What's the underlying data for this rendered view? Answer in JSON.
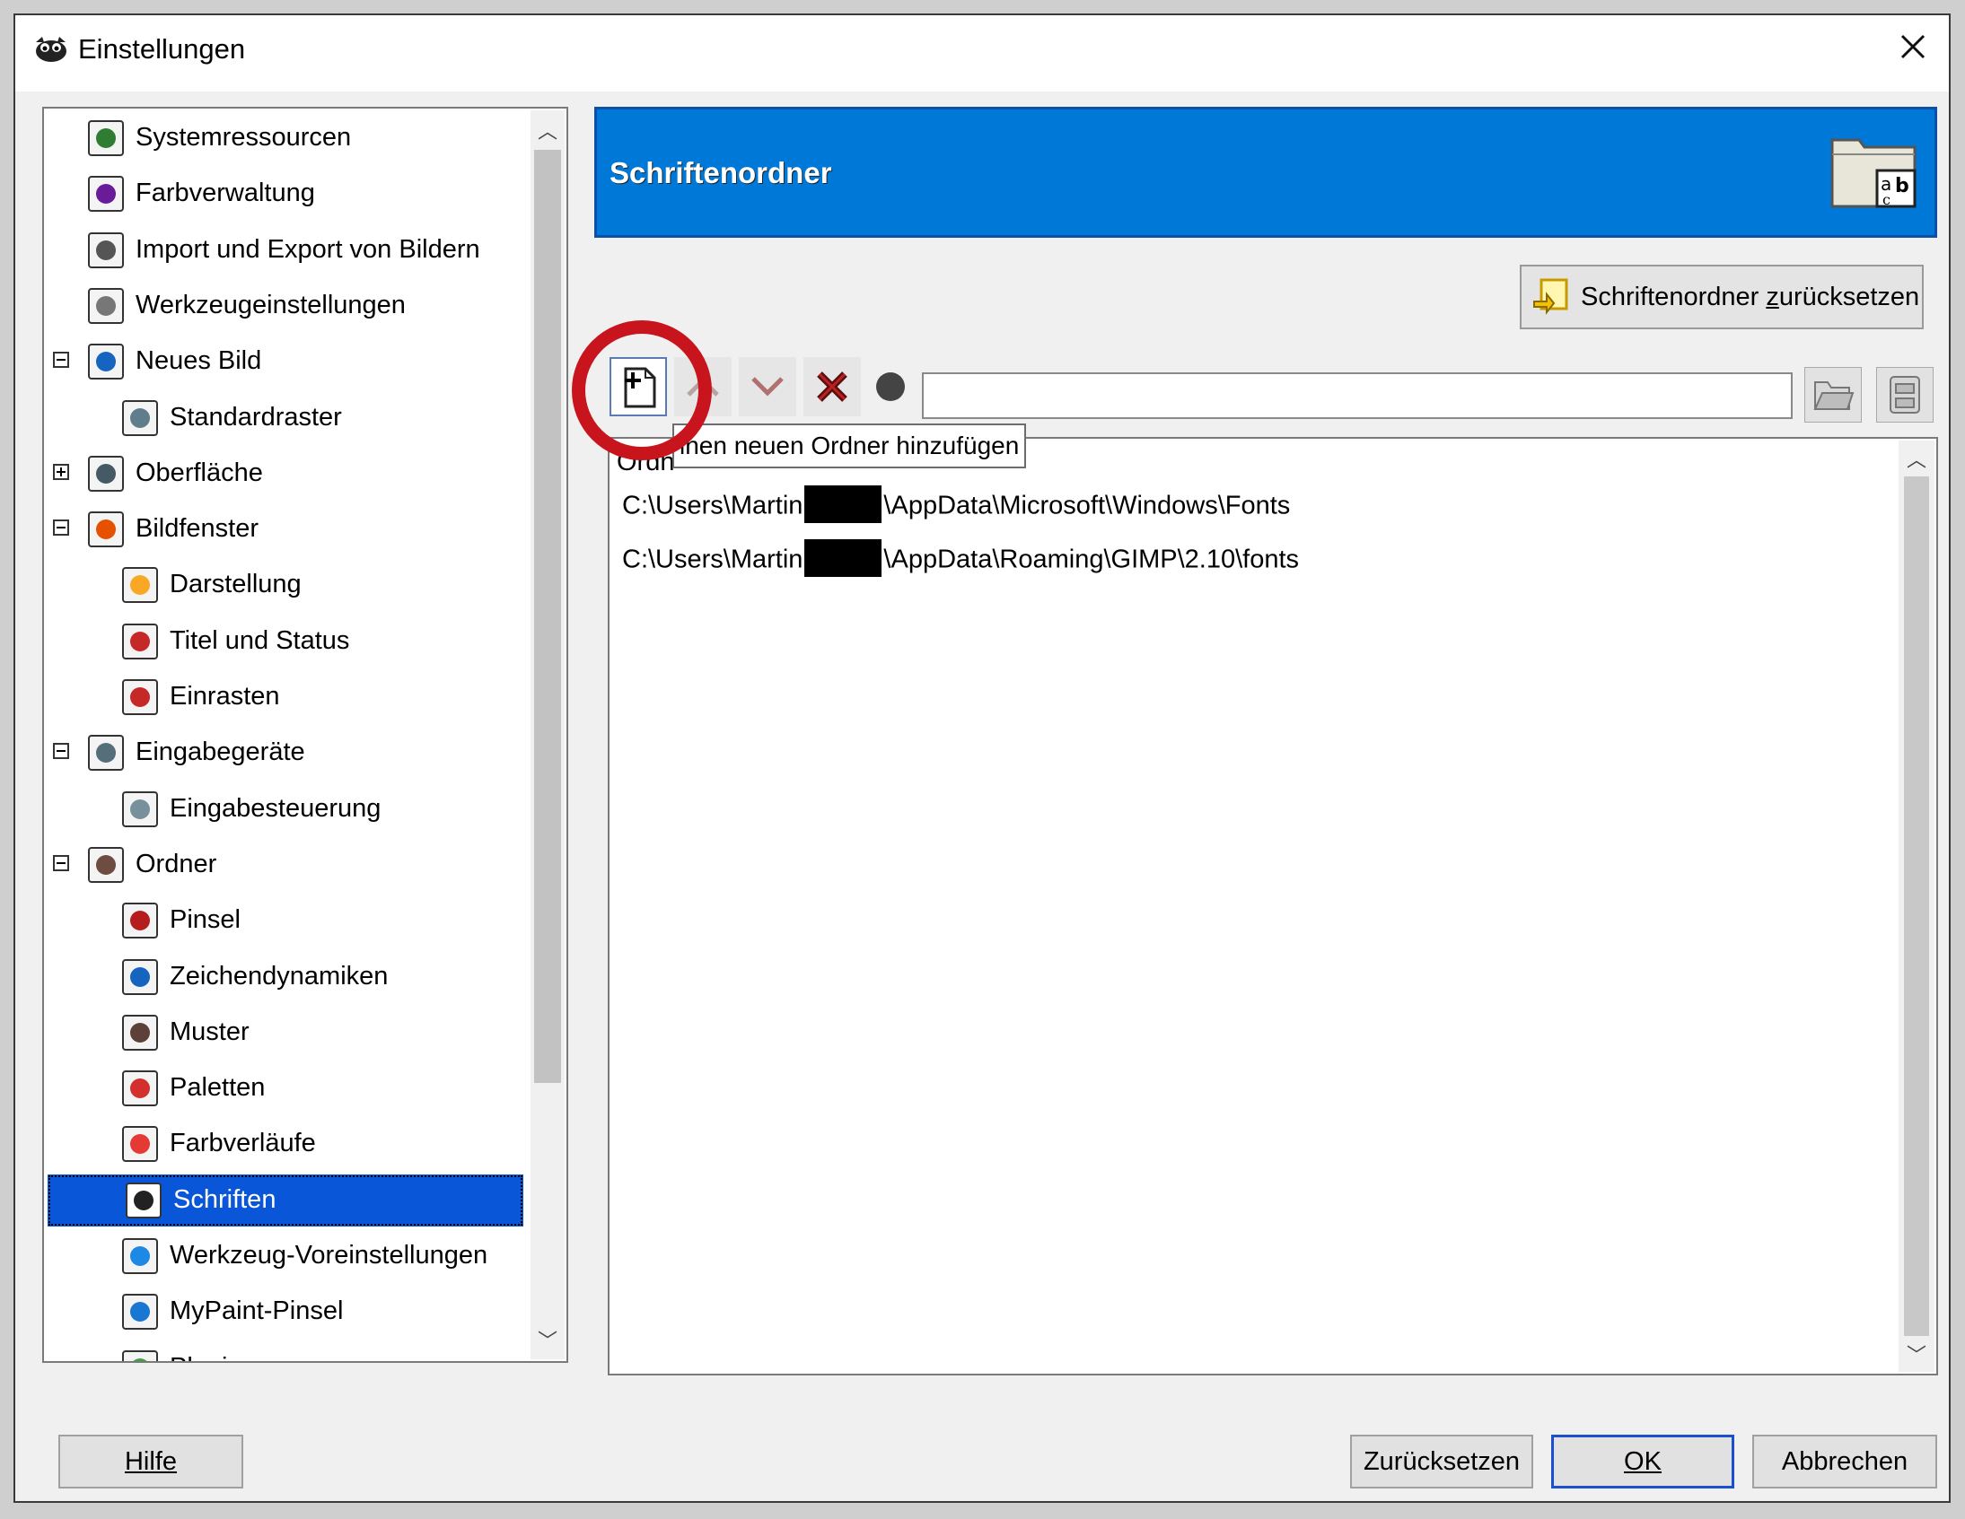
{
  "window": {
    "title": "Einstellungen",
    "close_label": "×"
  },
  "sidebar": {
    "items": [
      {
        "label": "Systemressourcen",
        "icon": "system-resources-icon"
      },
      {
        "label": "Farbverwaltung",
        "icon": "color-management-icon"
      },
      {
        "label": "Import und Export von Bildern",
        "icon": "import-export-icon"
      },
      {
        "label": "Werkzeugeinstellungen",
        "icon": "tool-options-icon"
      },
      {
        "label": "Neues Bild",
        "icon": "new-image-icon",
        "expanded": true
      },
      {
        "label": "Standardraster",
        "icon": "default-grid-icon"
      },
      {
        "label": "Oberfläche",
        "icon": "interface-icon",
        "expanded": false
      },
      {
        "label": "Bildfenster",
        "icon": "image-window-icon",
        "expanded": true
      },
      {
        "label": "Darstellung",
        "icon": "appearance-icon"
      },
      {
        "label": "Titel und Status",
        "icon": "title-status-icon"
      },
      {
        "label": "Einrasten",
        "icon": "snapping-icon"
      },
      {
        "label": "Eingabegeräte",
        "icon": "input-devices-icon",
        "expanded": true
      },
      {
        "label": "Eingabesteuerung",
        "icon": "input-controllers-icon"
      },
      {
        "label": "Ordner",
        "icon": "folders-icon",
        "expanded": true
      },
      {
        "label": "Pinsel",
        "icon": "brush-icon"
      },
      {
        "label": "Zeichendynamiken",
        "icon": "paint-dynamics-icon"
      },
      {
        "label": "Muster",
        "icon": "patterns-icon"
      },
      {
        "label": "Paletten",
        "icon": "palettes-icon"
      },
      {
        "label": "Farbverläufe",
        "icon": "gradients-icon"
      },
      {
        "label": "Schriften",
        "icon": "fonts-icon",
        "selected": true
      },
      {
        "label": "Werkzeug-Voreinstellungen",
        "icon": "tool-presets-icon"
      },
      {
        "label": "MyPaint-Pinsel",
        "icon": "mypaint-brushes-icon"
      },
      {
        "label": "Plugins",
        "icon": "plugins-icon"
      }
    ]
  },
  "page": {
    "title": "Schriftenordner",
    "header_icon": "font-folder-icon",
    "reset_button_prefix": "Schriftenordner ",
    "reset_button_underlined": "z",
    "reset_button_rest": "urücksetzen"
  },
  "toolbar": {
    "tooltip": "Einen neuen Ordner hinzufügen",
    "tooltip_visible": "inen neuen Ordner hinzufügen",
    "path_value": ""
  },
  "folder_list": {
    "header": "Ordn",
    "rows": [
      {
        "prefix": "C:\\Users\\Martin",
        "suffix": "\\AppData\\Microsoft\\Windows\\Fonts"
      },
      {
        "prefix": "C:\\Users\\Martin",
        "suffix": "\\AppData\\Roaming\\GIMP\\2.10\\fonts"
      }
    ]
  },
  "buttons": {
    "help": "Hilfe",
    "reset": "Zurücksetzen",
    "ok": "OK",
    "cancel": "Abbrechen"
  },
  "colors": {
    "header_blue": "#0078d7",
    "selection_blue": "#0a56d8",
    "highlight_red": "#c8141c"
  }
}
